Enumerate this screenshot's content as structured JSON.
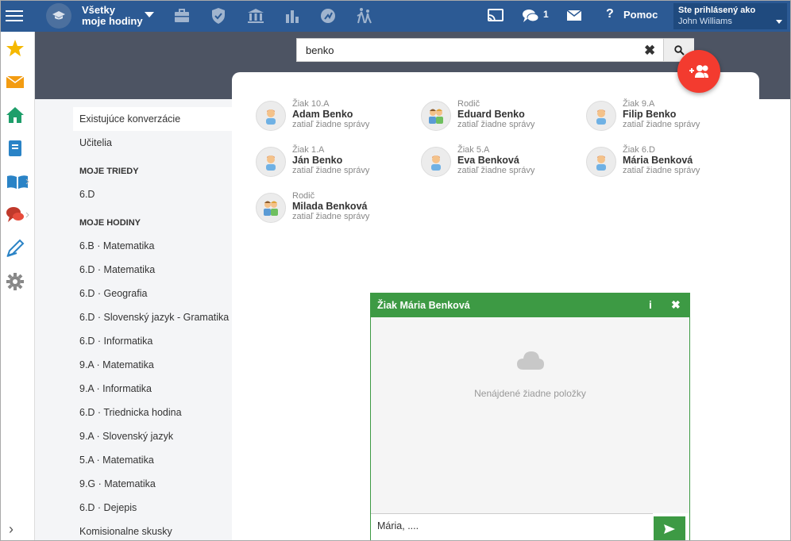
{
  "topbar": {
    "title_line1": "Všetky",
    "title_line2": "moje hodiny",
    "chat_count": "1",
    "help_label": "Pomoc",
    "user_caption": "Ste prihlásený ako",
    "user_name": "John Williams",
    "nav_icons": [
      "briefcase-icon",
      "shield-icon",
      "bank-icon",
      "bar-chart-icon",
      "running-icon",
      "walking-people-icon"
    ]
  },
  "rail": {
    "icons": [
      "star-icon",
      "mail-icon",
      "home-icon",
      "notebook-icon",
      "book-icon",
      "chat-bubbles-icon",
      "pencil-icon",
      "gear-icon"
    ]
  },
  "search": {
    "value": "benko",
    "placeholder": ""
  },
  "sidebar": {
    "items_top": [
      "Existujúce konverzácie",
      "Učitelia"
    ],
    "section_classes": "MOJE TRIEDY",
    "classes": [
      "6.D"
    ],
    "section_lessons": "MOJE HODINY",
    "lessons": [
      "6.B · Matematika",
      "6.D · Matematika",
      "6.D · Geografia",
      "6.D · Slovenský jazyk - Gramatika",
      "6.D · Informatika",
      "9.A · Matematika",
      "9.A · Informatika",
      "6.D · Triednicka hodina",
      "9.A · Slovenský jazyk",
      "5.A · Matematika",
      "9.G · Matematika",
      "6.D · Dejepis",
      "Komisionalne skusky"
    ]
  },
  "results": [
    {
      "role": "Žiak 10.A",
      "name": "Adam Benko",
      "status": "zatiaľ žiadne správy",
      "type": "student"
    },
    {
      "role": "Rodič",
      "name": "Eduard Benko",
      "status": "zatiaľ žiadne správy",
      "type": "parent"
    },
    {
      "role": "Žiak 9.A",
      "name": "Filip Benko",
      "status": "zatiaľ žiadne správy",
      "type": "student"
    },
    {
      "role": "Žiak 1.A",
      "name": "Ján Benko",
      "status": "zatiaľ žiadne správy",
      "type": "student"
    },
    {
      "role": "Žiak 5.A",
      "name": "Eva Benková",
      "status": "zatiaľ žiadne správy",
      "type": "student"
    },
    {
      "role": "Žiak 6.D",
      "name": "Mária Benková",
      "status": "zatiaľ žiadne správy",
      "type": "student"
    },
    {
      "role": "Rodič",
      "name": "Milada Benková",
      "status": "zatiaľ žiadne správy",
      "type": "parent"
    }
  ],
  "chat_window": {
    "title": "Žiak Mária Benková",
    "info_label": "i",
    "close_label": "✖",
    "empty_message": "Nenájdené žiadne položky",
    "input_value": "Mária, ...."
  },
  "colors": {
    "topbar": "#2c5a94",
    "band": "#4d5463",
    "chat_green": "#3d9a44",
    "fab_red": "#f33b2f"
  }
}
